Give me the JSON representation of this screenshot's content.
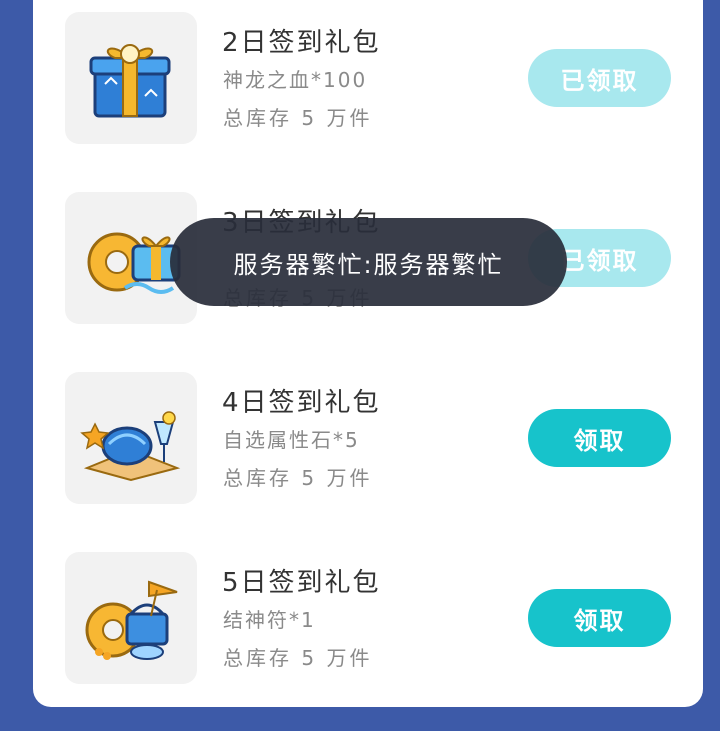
{
  "colors": {
    "page_bg": "#3d5aa8",
    "card_bg": "#ffffff",
    "thumb_bg": "#f2f2f2",
    "button_active": "#17c3cb",
    "button_claimed": "#a8e8ee",
    "toast_bg": "#282c3a"
  },
  "rewards": [
    {
      "title": "2日签到礼包",
      "item": "神龙之血*100",
      "stock": "总库存 5 万件",
      "button": "已领取",
      "icon": "gift-box-icon"
    },
    {
      "title": "3日签到礼包",
      "item": "",
      "stock": "总库存 5 万件",
      "button": "已领取",
      "icon": "swim-ring-icon"
    },
    {
      "title": "4日签到礼包",
      "item": "自选属性石*5",
      "stock": "总库存 5 万件",
      "button": "领取",
      "icon": "beach-shell-drink-icon"
    },
    {
      "title": "5日签到礼包",
      "item": "结神符*1",
      "stock": "总库存 5 万件",
      "button": "领取",
      "icon": "picnic-basket-icon"
    }
  ],
  "toast": {
    "message": "服务器繁忙:服务器繁忙"
  }
}
